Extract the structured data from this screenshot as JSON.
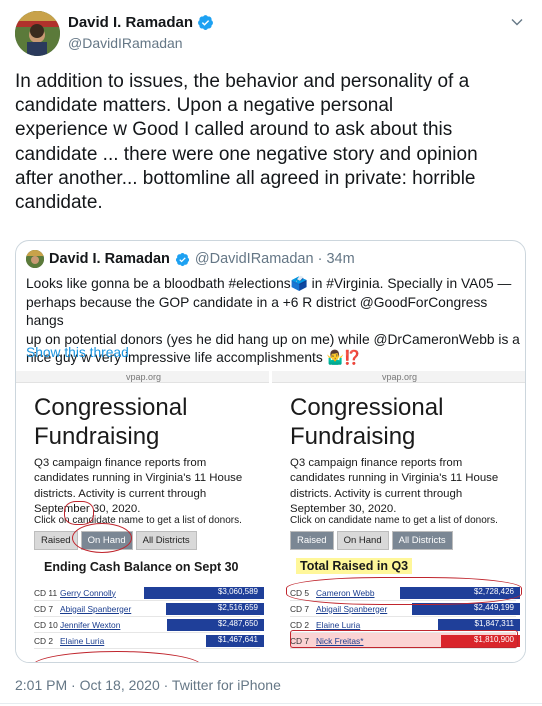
{
  "author": {
    "name": "David I. Ramadan",
    "handle": "@DavidIRamadan"
  },
  "tweet": {
    "text": "In addition to issues, the behavior and personality of a\ncandidate matters. Upon a negative personal\nexperience w Good I called around to ask about this\ncandidate ... there were one negative story and opinion\nafter another... bottomline all agreed in private: horrible\ncandidate."
  },
  "quoted": {
    "name": "David I. Ramadan",
    "handle_time": "@DavidIRamadan · 34m",
    "text": "Looks like gonna be a bloodbath #elections🗳️ in #Virginia. Specially in VA05 —\nperhaps because the GOP candidate in a +6 R district @GoodForCongress hangs\nup on potential donors (yes he did hang up on me) while @DrCameronWebb is a\nnice guy w very impressive life accomplishments 🤷‍♂️⁉️",
    "show_thread": "Show this thread"
  },
  "images": {
    "left": {
      "url": "vpap.org",
      "title_line1": "Congressional",
      "title_line2": "Fundraising",
      "desc": "Q3 campaign finance reports from candidates running in Virginia's 11 House districts. Activity is current through September 30, 2020.",
      "click_text": "Click on candidate name to get a list of donors.",
      "tabs": [
        "Raised",
        "On Hand",
        "All Districts"
      ],
      "heading": "Ending Cash Balance on Sept 30",
      "rows": [
        {
          "cd": "CD 11",
          "name": "Gerry Connolly",
          "value": "$3,060,589",
          "fraction": 1.0,
          "color": "blue"
        },
        {
          "cd": "CD 7",
          "name": "Abigail Spanberger",
          "value": "$2,516,659",
          "fraction": 0.82,
          "color": "blue"
        },
        {
          "cd": "CD 10",
          "name": "Jennifer Wexton",
          "value": "$2,487,650",
          "fraction": 0.81,
          "color": "blue"
        },
        {
          "cd": "CD 2",
          "name": "Elaine Luria",
          "value": "$1,467,641",
          "fraction": 0.48,
          "color": "blue"
        }
      ]
    },
    "right": {
      "url": "vpap.org",
      "title_line1": "Congressional",
      "title_line2": "Fundraising",
      "desc": "Q3 campaign finance reports from candidates running in Virginia's 11 House districts. Activity is current through September 30, 2020.",
      "click_text": "Click on candidate name to get a list of donors.",
      "tabs": [
        "Raised",
        "On Hand",
        "All Districts"
      ],
      "heading": "Total Raised in Q3",
      "rows": [
        {
          "cd": "CD 5",
          "name": "Cameron Webb",
          "value": "$2,728,426",
          "fraction": 1.0,
          "color": "blue"
        },
        {
          "cd": "CD 7",
          "name": "Abigail Spanberger",
          "value": "$2,449,199",
          "fraction": 0.9,
          "color": "blue"
        },
        {
          "cd": "CD 2",
          "name": "Elaine Luria",
          "value": "$1,847,311",
          "fraction": 0.68,
          "color": "blue"
        },
        {
          "cd": "CD 7",
          "name": "Nick Freitas*",
          "value": "$1,810,900",
          "fraction": 0.66,
          "color": "red"
        }
      ]
    }
  },
  "footer": {
    "timestamp": "2:01 PM · Oct 18, 2020 · Twitter for iPhone"
  },
  "colors": {
    "link": "#1b95e0",
    "verified": "#1da1f2",
    "bar_blue": "#1f3f99",
    "bar_red": "#d9252b"
  }
}
